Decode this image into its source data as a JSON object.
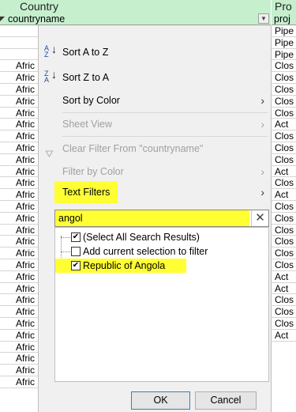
{
  "sheet": {
    "header_left": "Country",
    "header_right": "Pro",
    "filter_col_left": "countryname",
    "filter_col_right": "proj",
    "col_a_cells": [
      "",
      "",
      "",
      "Afric",
      "Afric",
      "Afric",
      "Afric",
      "Afric",
      "Afric",
      "Afric",
      "Afric",
      "Afric",
      "Afric",
      "Afric",
      "Afric",
      "Afric",
      "Afric",
      "Afric",
      "Afric",
      "Afric",
      "Afric",
      "Afric",
      "Afric",
      "Afric",
      "Afric",
      "Afric",
      "Afric",
      "Afric",
      "Afric",
      "Afric",
      "Afric"
    ],
    "col_b_cells": [
      "Pipe",
      "Pipe",
      "Pipe",
      "Clos",
      "Clos",
      "Clos",
      "Clos",
      "Clos",
      "Act",
      "Clos",
      "Clos",
      "Clos",
      "Act",
      "Clos",
      "Act",
      "Clos",
      "Clos",
      "Clos",
      "Clos",
      "Clos",
      "Clos",
      "Act",
      "Act",
      "Clos",
      "Clos",
      "Clos",
      "Act"
    ]
  },
  "menu": {
    "sort_az": "Sort A to Z",
    "sort_za": "Sort Z to A",
    "sort_by_color": "Sort by Color",
    "sheet_view": "Sheet View",
    "clear_filter": "Clear Filter From \"countryname\"",
    "filter_by_color": "Filter by Color",
    "text_filters": "Text Filters",
    "search_value": "angol",
    "list": {
      "select_all": "(Select All Search Results)",
      "add_selection": "Add current selection to filter",
      "angola": "Republic of Angola"
    },
    "ok": "OK",
    "cancel": "Cancel"
  },
  "colors": {
    "header_bg": "#c6efce",
    "highlight": "#ffff33",
    "menu_bg": "#f0f0f0"
  },
  "icons": [
    "sort-az-icon",
    "sort-za-icon",
    "clear-filter-icon",
    "chevron-right-icon",
    "close-icon",
    "dropdown-icon"
  ]
}
